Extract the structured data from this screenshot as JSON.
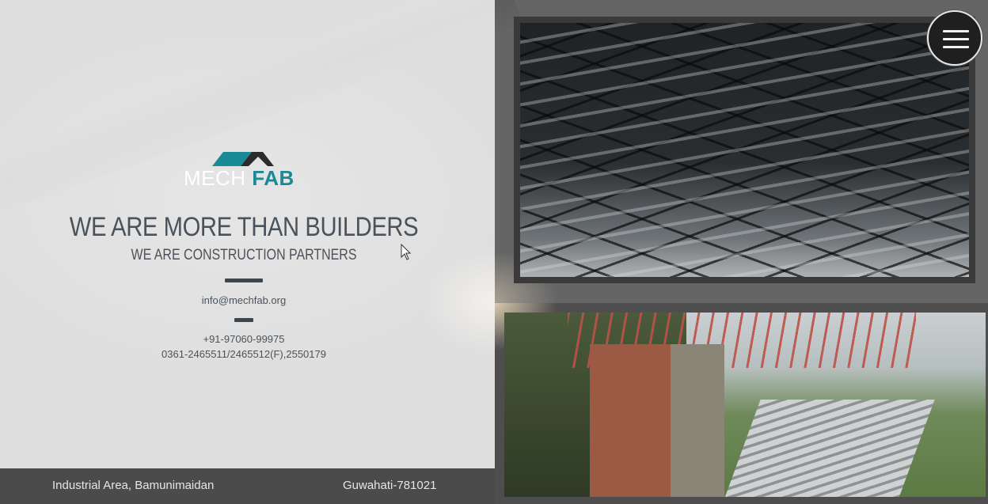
{
  "brand": {
    "logo_word1": "MECH",
    "logo_word2": "FAB",
    "logo_color_white": "#ffffff",
    "logo_color_teal": "#1a8a96"
  },
  "hero": {
    "headline": "WE ARE MORE THAN BUILDERS",
    "subline": "WE ARE CONSTRUCTION PARTNERS"
  },
  "contact": {
    "email": "info@mechfab.org",
    "phone_mobile": "+91-97060-99975",
    "phone_landline": "0361-2465511/2465512(F),2550179"
  },
  "footer": {
    "address_line1": "Industrial Area, Bamunimaidan",
    "address_line2": "Guwahati-781021"
  },
  "menu": {
    "icon": "hamburger-menu-icon"
  },
  "colors": {
    "text_dark": "#4a535b",
    "footer_bg": "#4b4b4b",
    "panel_bg": "#f4f4f4"
  }
}
